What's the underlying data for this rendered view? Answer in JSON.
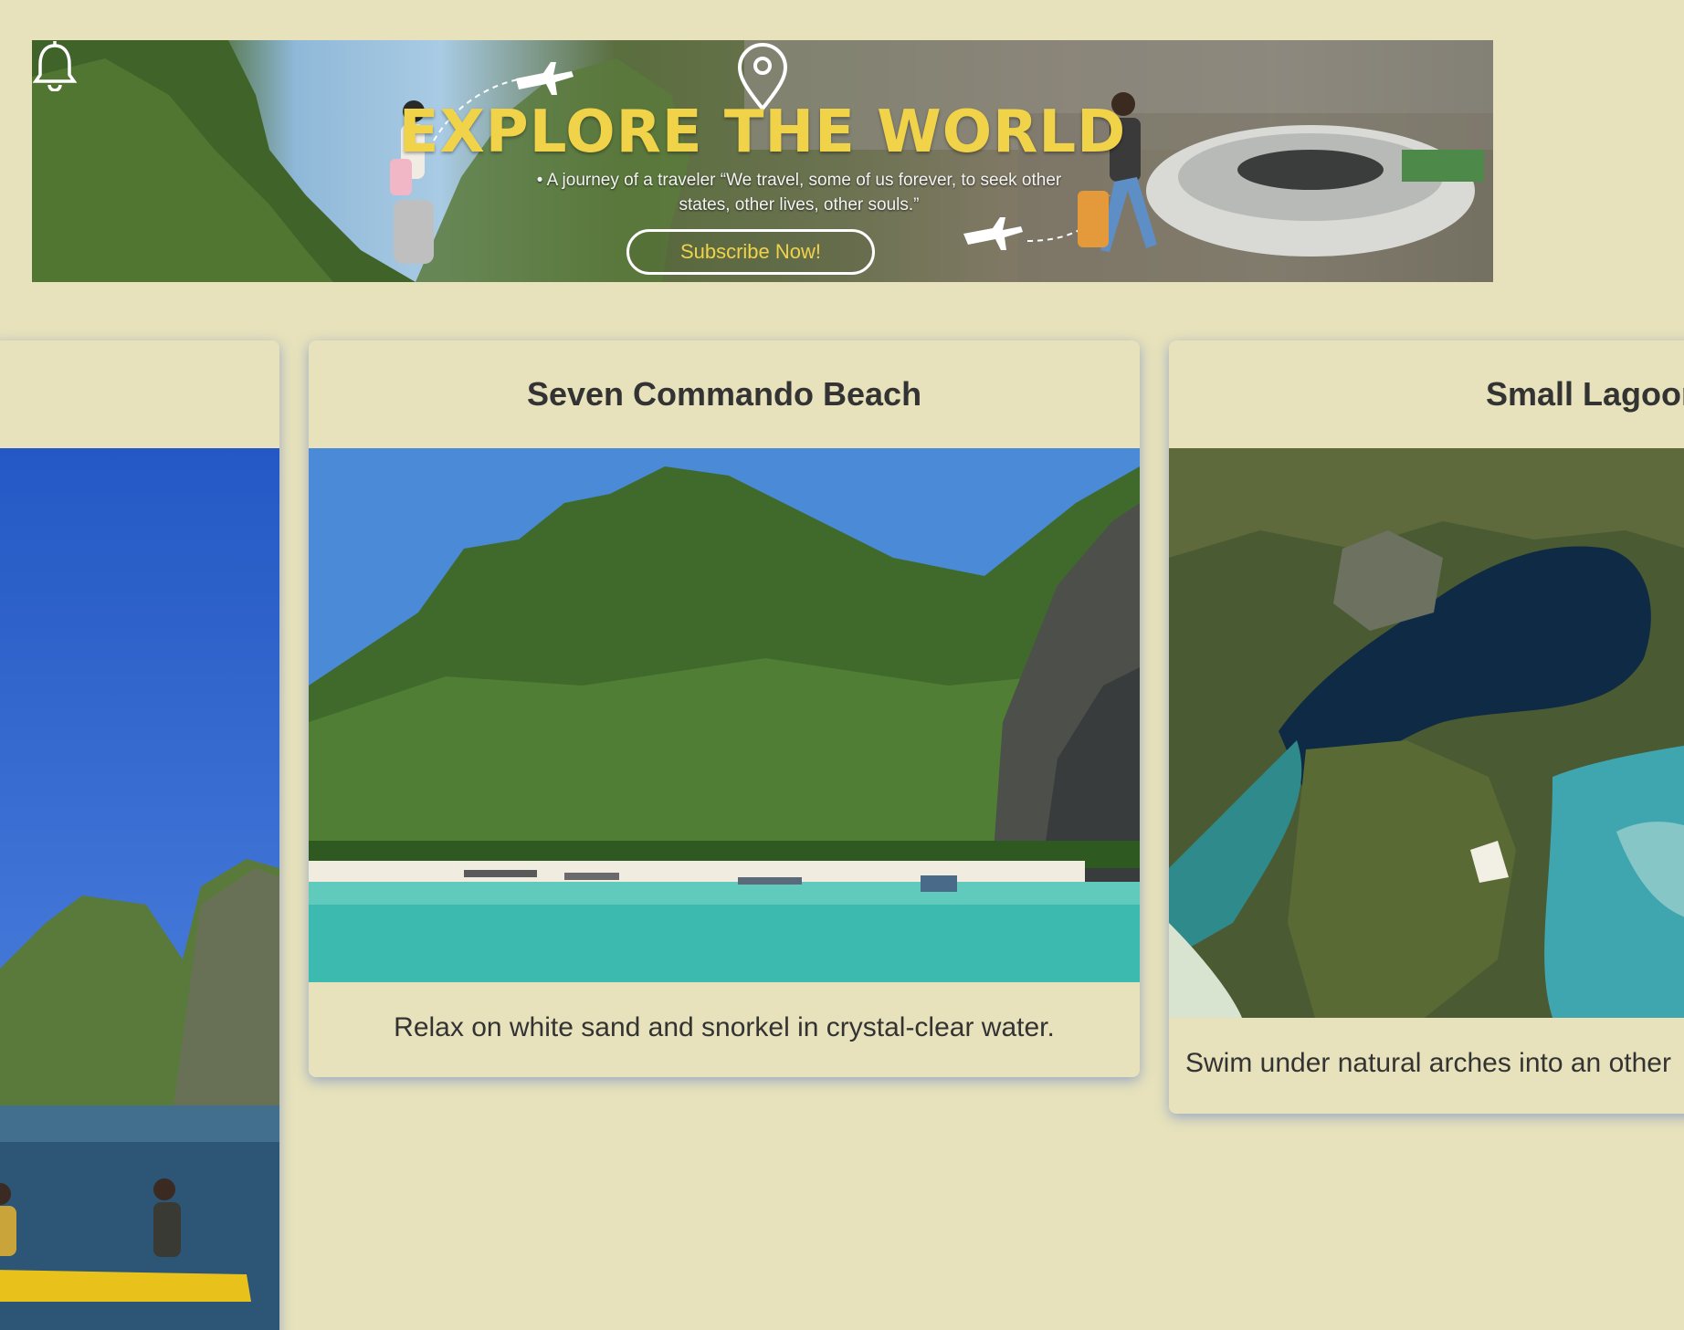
{
  "banner": {
    "title": "EXPLORE THE WORLD",
    "quote_line1": "• A journey of a traveler “We travel, some of us forever, to seek other",
    "quote_line2": "states, other lives, other souls.”",
    "subscribe_label": "Subscribe Now!"
  },
  "cards": [
    {
      "title": "",
      "description": ""
    },
    {
      "title": "Seven Commando Beach",
      "description": "Relax on white sand and snorkel in crystal-clear water."
    },
    {
      "title": "Small Lagoon",
      "description": "Swim under natural arches into an other"
    }
  ],
  "colors": {
    "background": "#e7e2bb",
    "title_yellow": "#f1d34a",
    "card_shadow": "#5a78c8"
  }
}
